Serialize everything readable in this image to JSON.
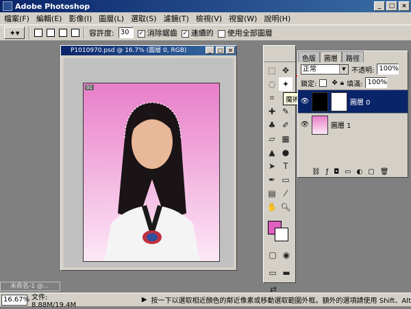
{
  "app": {
    "title": "Adobe Photoshop"
  },
  "menu": [
    "檔案(F)",
    "編輯(E)",
    "影像(I)",
    "圖層(L)",
    "選取(S)",
    "濾鏡(T)",
    "檢視(V)",
    "視窗(W)",
    "說明(H)"
  ],
  "options": {
    "tolerance_label": "容許度:",
    "tolerance_value": "30",
    "antialias_label": "消除鋸齒",
    "contiguous_label": "連續的",
    "all_layers_label": "使用全部圖層"
  },
  "document": {
    "title": "P1010970.psd @ 16.7% (圖層 0, RGB)",
    "badge": "01"
  },
  "tooltip": "魔術棒工具 (W)",
  "layers_panel": {
    "tabs": [
      "色版",
      "圖層",
      "路徑"
    ],
    "blend_mode": "正常",
    "opacity_label": "不透明:",
    "opacity_value": "100%",
    "lock_label": "鎖定:",
    "fill_label": "填滿:",
    "fill_value": "100%",
    "layers": [
      {
        "name": "圖層 0"
      },
      {
        "name": "圖層 1"
      }
    ]
  },
  "minimized_window": "未命名-1 @...",
  "status": {
    "zoom": "16.67%",
    "doc_size": "文件: 8.88M/19.4M",
    "hint": "按一下以選取相近顏色的鄰近像素或移動選取範圍外框。額外的選項請使用 Shift、Alt"
  },
  "colors": {
    "title_bar": "#0a246a",
    "foreground": "#e060c0",
    "background": "#ffffff",
    "highlight": "#e00000"
  }
}
